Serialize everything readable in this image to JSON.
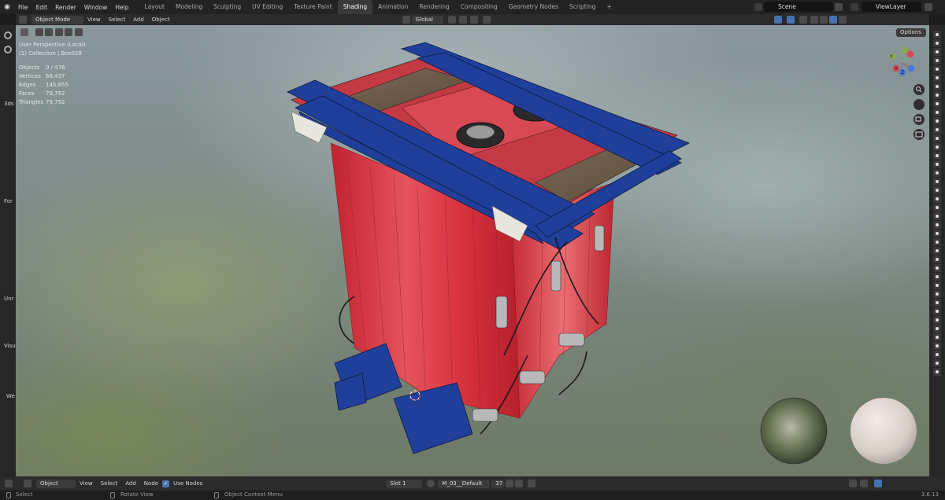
{
  "topbar": {
    "menu": [
      "File",
      "Edit",
      "Render",
      "Window",
      "Help"
    ],
    "tabs": [
      "Layout",
      "Modeling",
      "Sculpting",
      "UV Editing",
      "Texture Paint",
      "Shading",
      "Animation",
      "Rendering",
      "Compositing",
      "Geometry Nodes",
      "Scripting"
    ],
    "active_tab": "Shading",
    "add_tab": "+",
    "scene": "Scene",
    "view_layer": "ViewLayer"
  },
  "header": {
    "mode": "Object Mode",
    "menu": [
      "View",
      "Select",
      "Add",
      "Object"
    ],
    "orientation": "Global",
    "options": "Options"
  },
  "viewport": {
    "view_name": "User Perspective (Local)",
    "collection": "(1) Collection | Box028",
    "stats": [
      {
        "label": "Objects",
        "value": "0 / 476"
      },
      {
        "label": "Vertices",
        "value": "68,437"
      },
      {
        "label": "Edges",
        "value": "145,855"
      },
      {
        "label": "Faces",
        "value": "79,752"
      },
      {
        "label": "Triangles",
        "value": "79,752"
      }
    ],
    "gizmo": {
      "x": "X",
      "y": "Y",
      "z": "Z"
    }
  },
  "left_panel_labels": [
    "3ds",
    "For",
    "Unr",
    "Visu",
    "We"
  ],
  "node_header": {
    "editor": "Object",
    "menu": [
      "View",
      "Select",
      "Add",
      "Node"
    ],
    "use_nodes": "Use Nodes",
    "use_nodes_checked": true,
    "slot": "Slot 1",
    "material": "M_03__Default",
    "users": "37"
  },
  "statusbar": {
    "select": "Select",
    "rotate": "Rotate View",
    "context": "Object Context Menu",
    "version": "3.6.13"
  },
  "colors": {
    "accent": "#4772b3",
    "red_body": "#d8323f",
    "blue_frame": "#1f3f9a"
  }
}
